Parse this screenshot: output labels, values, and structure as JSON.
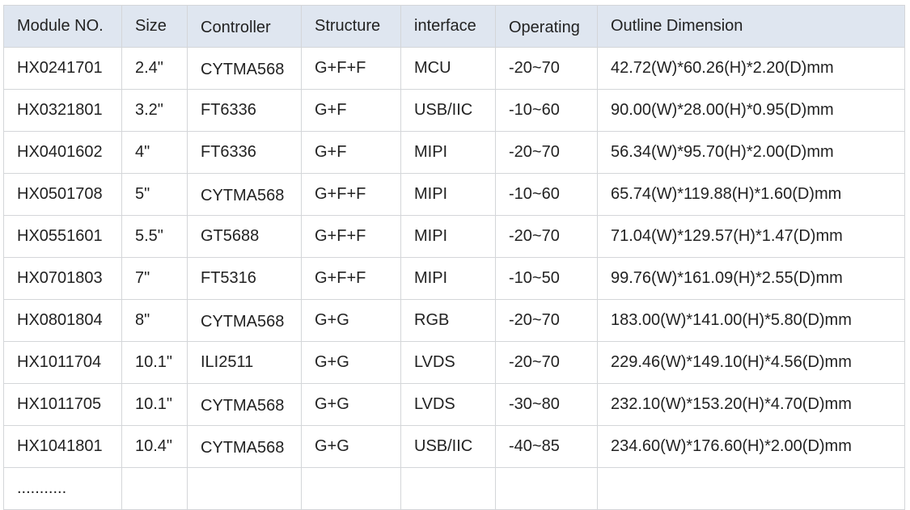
{
  "table": {
    "headers": [
      "Module NO.",
      "Size",
      "Controller",
      "Structure",
      "interface",
      "Operating",
      "Outline Dimension"
    ],
    "rows": [
      [
        "HX0241701",
        "2.4\"",
        "CYTMA568",
        "G+F+F",
        "MCU",
        "-20~70",
        "42.72(W)*60.26(H)*2.20(D)mm"
      ],
      [
        "HX0321801",
        "3.2\"",
        "FT6336",
        "G+F",
        "USB/IIC",
        "-10~60",
        "90.00(W)*28.00(H)*0.95(D)mm"
      ],
      [
        "HX0401602",
        "4\"",
        "FT6336",
        "G+F",
        "MIPI",
        "-20~70",
        "56.34(W)*95.70(H)*2.00(D)mm"
      ],
      [
        "HX0501708",
        "5\"",
        "CYTMA568",
        "G+F+F",
        "MIPI",
        "-10~60",
        "65.74(W)*119.88(H)*1.60(D)mm"
      ],
      [
        "HX0551601",
        "5.5\"",
        "GT5688",
        "G+F+F",
        "MIPI",
        "-20~70",
        "71.04(W)*129.57(H)*1.47(D)mm"
      ],
      [
        "HX0701803",
        "7\"",
        "FT5316",
        "G+F+F",
        "MIPI",
        "-10~50",
        "99.76(W)*161.09(H)*2.55(D)mm"
      ],
      [
        "HX0801804",
        "8\"",
        "CYTMA568",
        "G+G",
        "RGB",
        "-20~70",
        "183.00(W)*141.00(H)*5.80(D)mm"
      ],
      [
        "HX1011704",
        "10.1\"",
        "ILI2511",
        "G+G",
        "LVDS",
        "-20~70",
        "229.46(W)*149.10(H)*4.56(D)mm"
      ],
      [
        "HX1011705",
        "10.1\"",
        "CYTMA568",
        "G+G",
        "LVDS",
        "-30~80",
        "232.10(W)*153.20(H)*4.70(D)mm"
      ],
      [
        "HX1041801",
        "10.4\"",
        "CYTMA568",
        "G+G",
        "USB/IIC",
        "-40~85",
        "234.60(W)*176.60(H)*2.00(D)mm"
      ],
      [
        "...........",
        "",
        "",
        "",
        "",
        "",
        ""
      ]
    ]
  }
}
